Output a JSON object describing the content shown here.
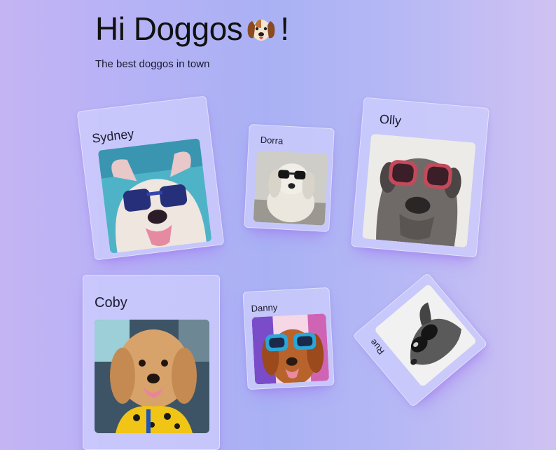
{
  "header": {
    "title": "Hi Doggos",
    "title_suffix": "!",
    "subtitle": "The best doggos in town",
    "title_icon": "dog-face-icon"
  },
  "dogs": [
    {
      "name": "Sydney",
      "photo": "dog with blue sunglasses by pool"
    },
    {
      "name": "Dorra",
      "photo": "fluffy white dog with black sunglasses"
    },
    {
      "name": "Olly",
      "photo": "gray mastiff with red sunglasses"
    },
    {
      "name": "Coby",
      "photo": "golden doodle in car seat"
    },
    {
      "name": "Danny",
      "photo": "golden retriever with teal sunglasses"
    },
    {
      "name": "Rue",
      "photo": "greyhound with sunglasses"
    }
  ],
  "colors": {
    "card_bg": "#cdcdfc",
    "card_shadow": "#a06ef0",
    "text": "#111111"
  }
}
